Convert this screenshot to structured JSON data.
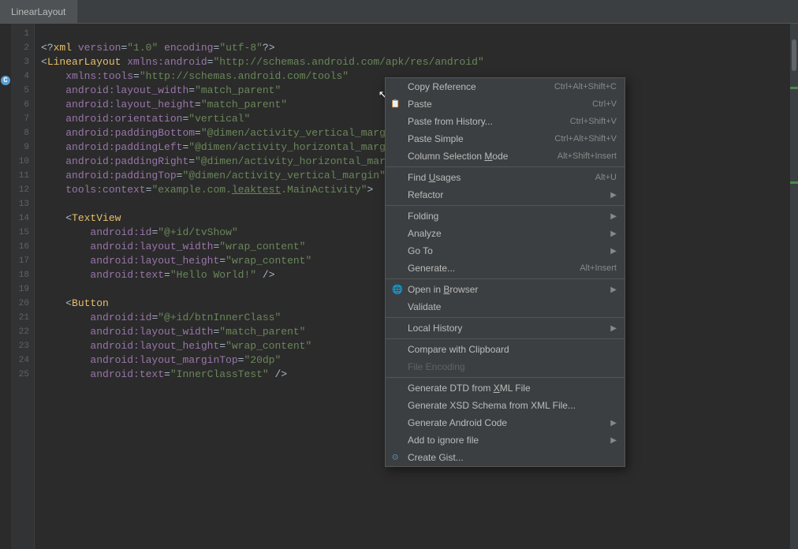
{
  "tab": {
    "label": "LinearLayout"
  },
  "code": {
    "lines": [
      "",
      "<?xml version=\"1.0\" encoding=\"utf-8\"?>",
      "<LinearLayout xmlns:android=\"http://schemas.android.com/apk/res/android\"",
      "    xmlns:tools=\"http://schemas.android.com/tools\"",
      "    android:layout_width=\"match_parent\"",
      "    android:layout_height=\"match_parent\"",
      "    android:orientation=\"vertical\"",
      "    android:paddingBottom=\"@dimen/activity_vertical_marg",
      "    android:paddingLeft=\"@dimen/activity_horizontal_marg",
      "    android:paddingRight=\"@dimen/activity_horizontal_mar",
      "    android:paddingTop=\"@dimen/activity_vertical_margin\"",
      "    tools:context=\"example.com.leaktest.MainActivity\">",
      "",
      "    <TextView",
      "        android:id=\"@+id/tvShow\"",
      "        android:layout_width=\"wrap_content\"",
      "        android:layout_height=\"wrap_content\"",
      "        android:text=\"Hello World!\" />",
      "",
      "    <Button",
      "        android:id=\"@+id/btnInnerClass\"",
      "        android:layout_width=\"match_parent\"",
      "        android:layout_height=\"wrap_content\"",
      "        android:layout_marginTop=\"20dp\"",
      "        android:text=\"InnerClassTest\" />"
    ]
  },
  "context_menu": {
    "items": [
      {
        "id": "copy-reference",
        "label": "Copy Reference",
        "shortcut": "Ctrl+Alt+Shift+C",
        "has_arrow": false,
        "disabled": false
      },
      {
        "id": "paste",
        "label": "Paste",
        "shortcut": "Ctrl+V",
        "has_arrow": false,
        "disabled": false,
        "has_icon": true
      },
      {
        "id": "paste-from-history",
        "label": "Paste from History...",
        "shortcut": "Ctrl+Shift+V",
        "has_arrow": false,
        "disabled": false
      },
      {
        "id": "paste-simple",
        "label": "Paste Simple",
        "shortcut": "Ctrl+Alt+Shift+V",
        "has_arrow": false,
        "disabled": false
      },
      {
        "id": "column-selection-mode",
        "label": "Column Selection Mode",
        "shortcut": "Alt+Shift+Insert",
        "has_arrow": false,
        "disabled": false
      },
      {
        "id": "separator1",
        "type": "separator"
      },
      {
        "id": "find-usages",
        "label": "Find Usages",
        "shortcut": "Alt+U",
        "has_arrow": false,
        "disabled": false
      },
      {
        "id": "refactor",
        "label": "Refactor",
        "shortcut": "",
        "has_arrow": true,
        "disabled": false
      },
      {
        "id": "separator2",
        "type": "separator"
      },
      {
        "id": "folding",
        "label": "Folding",
        "shortcut": "",
        "has_arrow": true,
        "disabled": false
      },
      {
        "id": "analyze",
        "label": "Analyze",
        "shortcut": "",
        "has_arrow": true,
        "disabled": false
      },
      {
        "id": "go-to",
        "label": "Go To",
        "shortcut": "",
        "has_arrow": true,
        "disabled": false
      },
      {
        "id": "generate",
        "label": "Generate...",
        "shortcut": "Alt+Insert",
        "has_arrow": false,
        "disabled": false
      },
      {
        "id": "separator3",
        "type": "separator"
      },
      {
        "id": "open-in-browser",
        "label": "Open in Browser",
        "shortcut": "",
        "has_arrow": true,
        "disabled": false,
        "has_globe": true
      },
      {
        "id": "validate",
        "label": "Validate",
        "shortcut": "",
        "has_arrow": false,
        "disabled": false
      },
      {
        "id": "separator4",
        "type": "separator"
      },
      {
        "id": "local-history",
        "label": "Local History",
        "shortcut": "",
        "has_arrow": true,
        "disabled": false
      },
      {
        "id": "separator5",
        "type": "separator"
      },
      {
        "id": "compare-clipboard",
        "label": "Compare with Clipboard",
        "shortcut": "",
        "has_arrow": false,
        "disabled": false
      },
      {
        "id": "file-encoding",
        "label": "File Encoding",
        "shortcut": "",
        "has_arrow": false,
        "disabled": true
      },
      {
        "id": "separator6",
        "type": "separator"
      },
      {
        "id": "gen-dtd",
        "label": "Generate DTD from XML File",
        "shortcut": "",
        "has_arrow": false,
        "disabled": false
      },
      {
        "id": "gen-xsd",
        "label": "Generate XSD Schema from XML File...",
        "shortcut": "",
        "has_arrow": false,
        "disabled": false
      },
      {
        "id": "gen-android",
        "label": "Generate Android Code",
        "shortcut": "",
        "has_arrow": true,
        "disabled": false
      },
      {
        "id": "add-ignore",
        "label": "Add to ignore file",
        "shortcut": "",
        "has_arrow": true,
        "disabled": false
      },
      {
        "id": "create-gist",
        "label": "Create Gist...",
        "shortcut": "",
        "has_arrow": false,
        "disabled": false,
        "has_gist_icon": true
      }
    ]
  }
}
